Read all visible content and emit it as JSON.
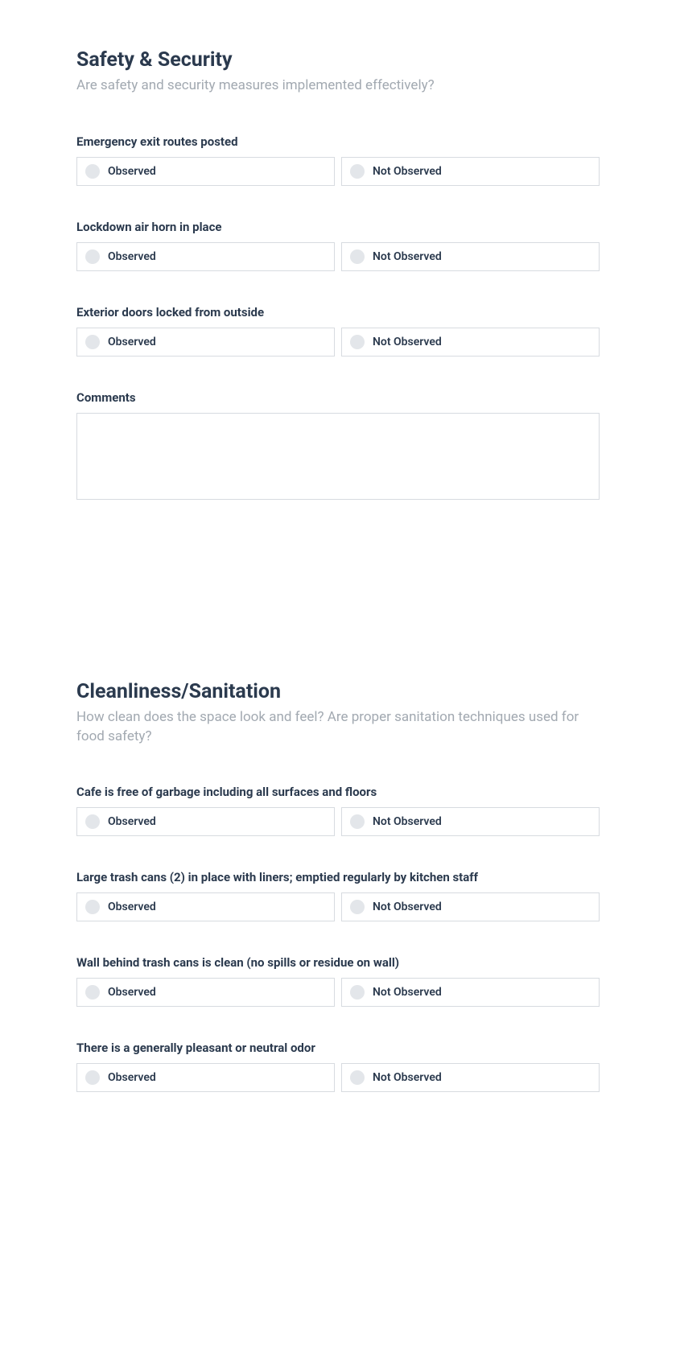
{
  "sections": [
    {
      "title": "Safety & Security",
      "subtitle": "Are safety and security measures implemented effectively?",
      "questions": [
        {
          "label": "Emergency exit routes posted",
          "options": [
            "Observed",
            "Not Observed"
          ]
        },
        {
          "label": "Lockdown air horn in place",
          "options": [
            "Observed",
            "Not Observed"
          ]
        },
        {
          "label": "Exterior doors locked from outside",
          "options": [
            "Observed",
            "Not Observed"
          ]
        }
      ],
      "comments_label": "Comments",
      "comments_value": ""
    },
    {
      "title": "Cleanliness/Sanitation",
      "subtitle": "How clean does the space look and feel? Are proper sanitation techniques used for food safety?",
      "questions": [
        {
          "label": "Cafe is free of garbage including all surfaces and floors",
          "options": [
            "Observed",
            "Not Observed"
          ]
        },
        {
          "label": "Large trash cans (2) in place with liners; emptied regularly by kitchen staff",
          "options": [
            "Observed",
            "Not Observed"
          ]
        },
        {
          "label": "Wall behind trash cans is clean (no spills or residue on wall)",
          "options": [
            "Observed",
            "Not Observed"
          ]
        },
        {
          "label": "There is a generally pleasant or neutral odor",
          "options": [
            "Observed",
            "Not Observed"
          ]
        }
      ]
    }
  ]
}
